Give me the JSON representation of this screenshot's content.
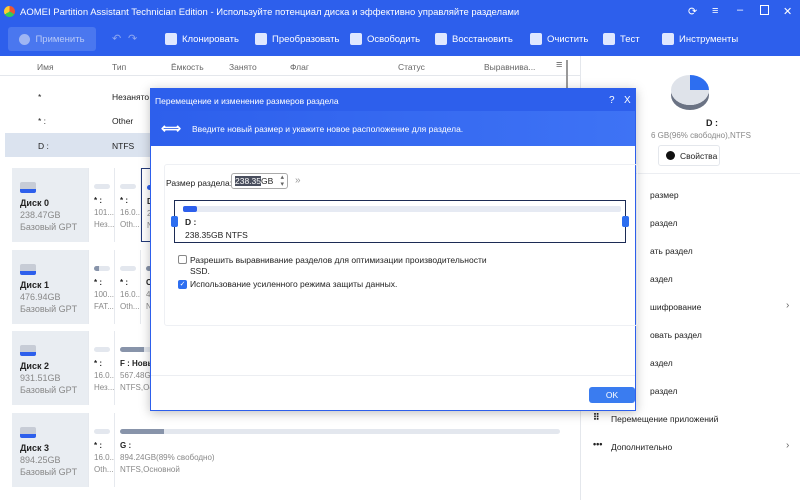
{
  "window": {
    "title": "AOMEI Partition Assistant Technician Edition - Используйте потенциал диска и эффективно управляйте разделами"
  },
  "toolbar": {
    "apply": "Применить",
    "items": [
      "Клонировать",
      "Преобразовать",
      "Освободить",
      "Восстановить",
      "Очистить",
      "Тест",
      "Инструменты"
    ]
  },
  "table": {
    "headers": [
      "Имя",
      "Тип",
      "Ёмкость",
      "Занято",
      "Флаг",
      "Статус",
      "Выравнива..."
    ],
    "rows": [
      {
        "name": "*",
        "type": "Незанято"
      },
      {
        "name": "* :",
        "type": "Other"
      },
      {
        "name": "D :",
        "type": "NTFS"
      }
    ]
  },
  "disks": [
    {
      "name": "Диск 0",
      "size": "238.47GB",
      "type": "Базовый GPT",
      "parts": [
        {
          "l": "* :",
          "s": "101...",
          "t": "Нез..."
        },
        {
          "l": "* :",
          "s": "16.0...",
          "t": "Oth..."
        },
        {
          "l": "D",
          "s": "2",
          "t": "N"
        }
      ]
    },
    {
      "name": "Диск 1",
      "size": "476.94GB",
      "type": "Базовый GPT",
      "parts": [
        {
          "l": "* :",
          "s": "100...",
          "t": "FAT..."
        },
        {
          "l": "* :",
          "s": "16.0...",
          "t": "Oth..."
        },
        {
          "l": "C",
          "s": "4",
          "t": "N"
        }
      ]
    },
    {
      "name": "Диск 2",
      "size": "931.51GB",
      "type": "Базовый GPT",
      "parts": [
        {
          "l": "* :",
          "s": "16.0...",
          "t": "Нез..."
        },
        {
          "l": "F : Новый",
          "s": "567.48GB",
          "t": "NTFS,Основной"
        }
      ]
    },
    {
      "name": "Диск 3",
      "size": "894.25GB",
      "type": "Базовый GPT",
      "parts": [
        {
          "l": "* :",
          "s": "16.0...",
          "t": "Oth..."
        },
        {
          "l": "G :",
          "s": "894.24GB(89% свободно)",
          "t": "NTFS,Основной"
        }
      ]
    }
  ],
  "right": {
    "drive": "D :",
    "info": "6 GB(96% свободно),NTFS",
    "properties": "Свойства",
    "menu": [
      "размер",
      "раздел",
      "ать раздел",
      "аздел",
      "шифрование",
      "овать раздел",
      "аздел",
      "раздел",
      "Перемещение приложений",
      "Дополнительно"
    ]
  },
  "dialog": {
    "title": "Перемещение и изменение размеров раздела",
    "help": "?",
    "close": "X",
    "subtitle": "Введите новый размер и укажите новое расположение для раздела.",
    "size_label": "Размер раздела:",
    "size_value": "238.35",
    "size_unit": "GB",
    "partition_name": "D :",
    "partition_info": "238.35GB NTFS",
    "align_label": "Разрешить выравнивание разделов для оптимизации производительности SSD.",
    "align_checked": false,
    "protect_label": "Использование усиленного режима защиты данных.",
    "protect_checked": true,
    "ok": "OK"
  }
}
